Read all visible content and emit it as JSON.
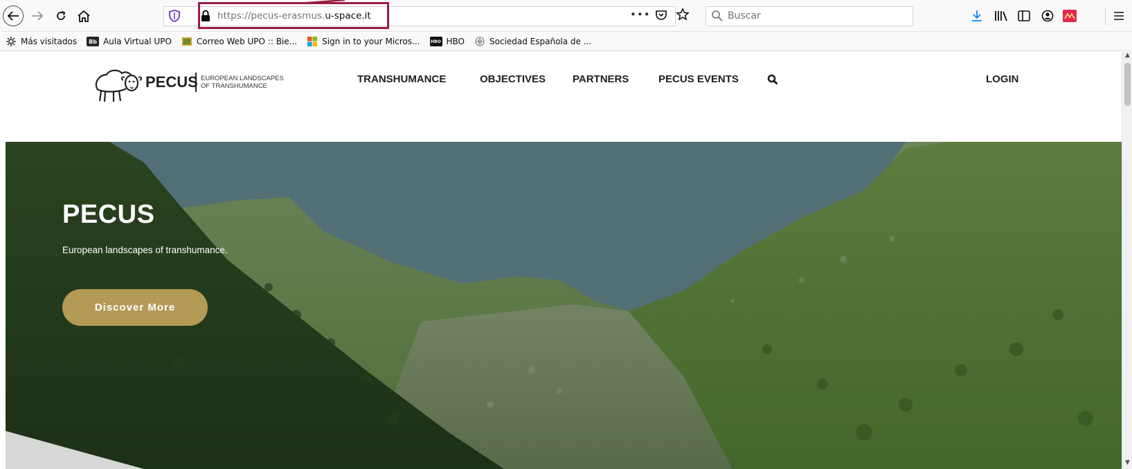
{
  "browser": {
    "url_prefix": "https://pecus-erasmus.",
    "url_domain": "u-space.it",
    "page_actions": "•••",
    "search_placeholder": "Buscar",
    "colors": {
      "highlight": "#9b1c3f",
      "download_arrow": "#0a84ff"
    }
  },
  "bookmarks": [
    {
      "label": "Más visitados",
      "icon": "gear-icon"
    },
    {
      "label": "Aula Virtual UPO",
      "icon": "blackboard-icon",
      "icon_text": "Bb"
    },
    {
      "label": "Correo Web UPO :: Bie...",
      "icon": "mail-icon"
    },
    {
      "label": "Sign in to your Micros...",
      "icon": "microsoft-icon"
    },
    {
      "label": "HBO",
      "icon": "hbo-icon",
      "icon_text": "HBO"
    },
    {
      "label": "Sociedad Española de ...",
      "icon": "globe-icon"
    }
  ],
  "site": {
    "logo_name": "PECUS",
    "logo_sub_line1": "EUROPEAN LANDSCAPES",
    "logo_sub_line2": "OF TRANSHUMANCE",
    "nav": [
      "TRANSHUMANCE",
      "OBJECTIVES",
      "PARTNERS",
      "PECUS EVENTS"
    ],
    "login": "LOGIN"
  },
  "hero": {
    "title": "PECUS",
    "subtitle": "European landscapes of transhumance.",
    "button": "Discover More",
    "button_color": "#b39a55"
  }
}
